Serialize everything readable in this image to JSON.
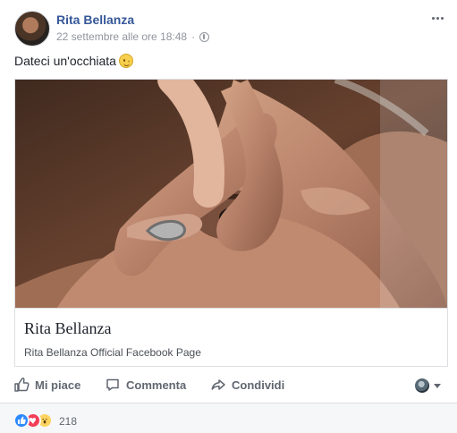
{
  "post": {
    "author": {
      "name": "Rita Bellanza",
      "avatar_icon": "profile-photo"
    },
    "timestamp": "22 settembre alle ore 18:48",
    "audience_icon": "globe-icon",
    "message": "Dateci un'occhiata",
    "message_emoji": "wink-icon",
    "link_preview": {
      "image_icon": "profile-photo-preview",
      "title": "Rita Bellanza",
      "description": "Rita Bellanza Official Facebook Page"
    },
    "actions": {
      "like": "Mi piace",
      "comment": "Commenta",
      "share": "Condividi"
    },
    "reactions": {
      "icons": [
        "like-reaction-icon",
        "love-reaction-icon",
        "wow-reaction-icon"
      ],
      "count": "218"
    },
    "colors": {
      "author_blue": "#365899",
      "action_gray": "#606770",
      "like_blue": "#2e89ff",
      "love_red": "#f33e58",
      "wow_yellow": "#fcd45f",
      "reaction_bar_bg": "#f6f7f9"
    }
  }
}
